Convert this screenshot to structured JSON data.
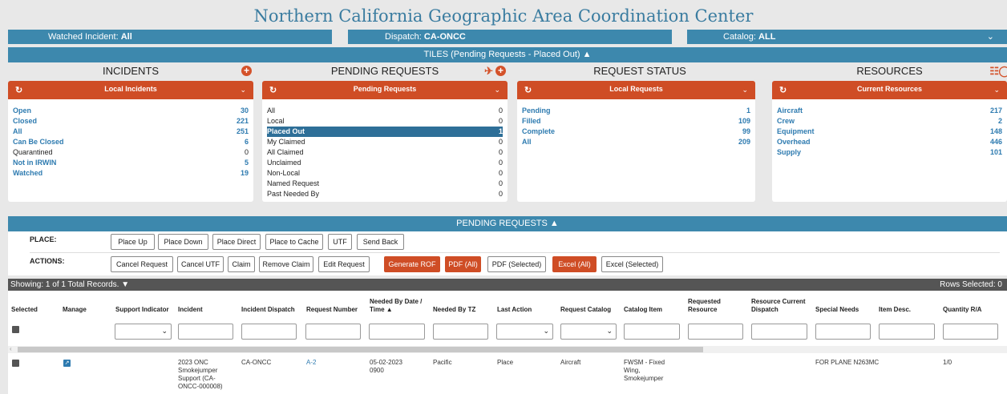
{
  "title": "Northern California Geographic Area Coordination Center",
  "filters": {
    "watched_label": "Watched Incident:",
    "watched_value": "All",
    "dispatch_label": "Dispatch:",
    "dispatch_value": "CA-ONCC",
    "catalog_label": "Catalog:",
    "catalog_value": "ALL"
  },
  "tiles_bar": "TILES (Pending Requests - Placed Out)",
  "tiles": {
    "incidents": {
      "heading": "INCIDENTS",
      "dropdown": "Local Incidents",
      "rows": [
        {
          "label": "Open",
          "value": "30"
        },
        {
          "label": "Closed",
          "value": "221"
        },
        {
          "label": "All",
          "value": "251"
        },
        {
          "label": "Can Be Closed",
          "value": "6"
        },
        {
          "label": "Quarantined",
          "value": "0"
        },
        {
          "label": "Not in IRWIN",
          "value": "5"
        },
        {
          "label": "Watched",
          "value": "19"
        }
      ]
    },
    "pending": {
      "heading": "PENDING REQUESTS",
      "dropdown": "Pending Requests",
      "rows": [
        {
          "label": "All",
          "value": "0"
        },
        {
          "label": "Local",
          "value": "0"
        },
        {
          "label": "Placed Out",
          "value": "1"
        },
        {
          "label": "My Claimed",
          "value": "0"
        },
        {
          "label": "All Claimed",
          "value": "0"
        },
        {
          "label": "Unclaimed",
          "value": "0"
        },
        {
          "label": "Non-Local",
          "value": "0"
        },
        {
          "label": "Named Request",
          "value": "0"
        },
        {
          "label": "Past Needed By",
          "value": "0"
        }
      ]
    },
    "status": {
      "heading": "REQUEST STATUS",
      "dropdown": "Local Requests",
      "rows": [
        {
          "label": "Pending",
          "value": "1"
        },
        {
          "label": "Filled",
          "value": "109"
        },
        {
          "label": "Complete",
          "value": "99"
        },
        {
          "label": "All",
          "value": "209"
        }
      ]
    },
    "resources": {
      "heading": "RESOURCES",
      "dropdown": "Current Resources",
      "rows": [
        {
          "label": "Aircraft",
          "value": "217"
        },
        {
          "label": "Crew",
          "value": "2"
        },
        {
          "label": "Equipment",
          "value": "148"
        },
        {
          "label": "Overhead",
          "value": "446"
        },
        {
          "label": "Supply",
          "value": "101"
        }
      ]
    }
  },
  "pending_bar": "PENDING REQUESTS",
  "place": {
    "label": "PLACE:",
    "buttons": [
      "Place Up",
      "Place Down",
      "Place Direct",
      "Place to Cache",
      "UTF",
      "Send Back"
    ]
  },
  "actions": {
    "label": "ACTIONS:",
    "buttons": [
      "Cancel Request",
      "Cancel UTF",
      "Claim",
      "Remove Claim",
      "Edit Request",
      "Generate ROF",
      "PDF (All)",
      "PDF (Selected)",
      "Excel (All)",
      "Excel (Selected)"
    ]
  },
  "showing": "Showing: 1 of 1 Total Records.",
  "rows_selected": "Rows Selected: 0",
  "columns": [
    "Selected",
    "Manage",
    "Support Indicator",
    "Incident",
    "Incident Dispatch",
    "Request Number",
    "Needed By Date / Time",
    "Needed By TZ",
    "Last Action",
    "Request Catalog",
    "Catalog Item",
    "Requested Resource",
    "Resource Current Dispatch",
    "Special Needs",
    "Item Desc.",
    "Quantity R/A"
  ],
  "record": {
    "incident": "2023 ONC Smokejumper Support (CA-ONCC-000008)",
    "incident_dispatch": "CA-ONCC",
    "request_number": "A-2",
    "needed_by": "05-02-2023 0900",
    "tz": "Pacific",
    "last_action": "Place",
    "catalog": "Aircraft",
    "catalog_item": "FWSM - Fixed Wing, Smokejumper",
    "special_needs": "FOR PLANE N263MC",
    "quantity": "1/0"
  },
  "colors": {
    "header_blue": "#3d88ad",
    "panel_orange": "#cf4d25",
    "link_blue": "#2e7bb0",
    "title_blue": "#3a7ca0"
  }
}
